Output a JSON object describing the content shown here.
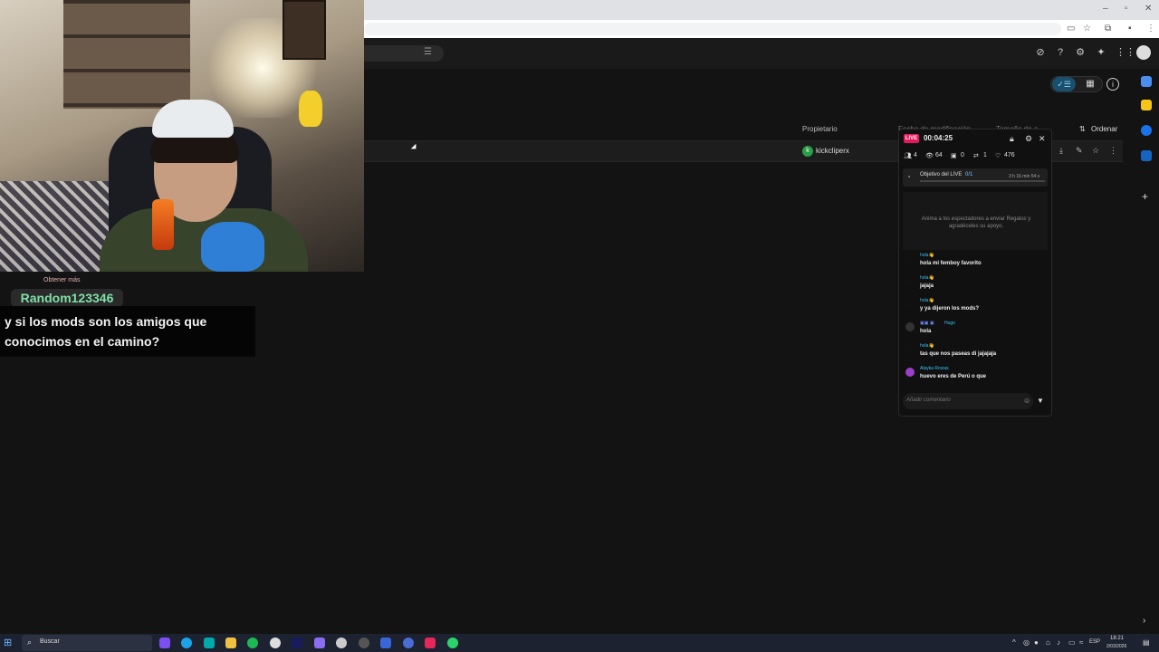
{
  "header": {
    "columns": {
      "owner": "Propietario",
      "modified": "Fecha de modificación",
      "size": "Tamaño de a...",
      "sort": "Ordenar"
    }
  },
  "file_row": {
    "owner_initial": "k",
    "owner_name": "kickcliperx"
  },
  "overlay": {
    "gift_caption": "Obtener más",
    "username": "Random123346",
    "message": "y si los mods son los amigos que conocimos en el camino?"
  },
  "live": {
    "badge": "LIVE",
    "timer": "00:04:25",
    "stats": {
      "viewers_now": "4",
      "views": "64",
      "gifts": "0",
      "shares": "1",
      "likes": "476"
    },
    "goal": {
      "label": "Objetivo del LIVE",
      "count": "0/1",
      "time_left": "3 h 16 min 54 s"
    },
    "promo": "Anima a los espectadores a enviar Regalos y agradéceles su apoyo.",
    "comments": [
      {
        "name": "hola👋",
        "text": "hola mi femboy favorito",
        "avatar": "#111"
      },
      {
        "name": "hola👋",
        "text": "jajaja",
        "avatar": "#111"
      },
      {
        "name": "hola👋",
        "text": "y ya dijeron los mods?",
        "avatar": "#111"
      },
      {
        "name": "Hugo",
        "text": "hola",
        "avatar": "#222"
      },
      {
        "name": "hola👋",
        "text": "tas que nos paseas di jajajaja",
        "avatar": "#111"
      },
      {
        "name": "Alayka Rovias",
        "text": "huevo eres de Perú o que",
        "avatar": "#9b3fc9"
      }
    ],
    "comment_placeholder": "Añadir comentario"
  },
  "taskbar": {
    "search_placeholder": "Buscar",
    "lang": "ESP",
    "time": "18:21",
    "date": "2/03/2026"
  },
  "colors": {
    "live_pink": "#e8175d",
    "chat_name": "#39c0f2",
    "username_green": "#7fe0a8"
  }
}
